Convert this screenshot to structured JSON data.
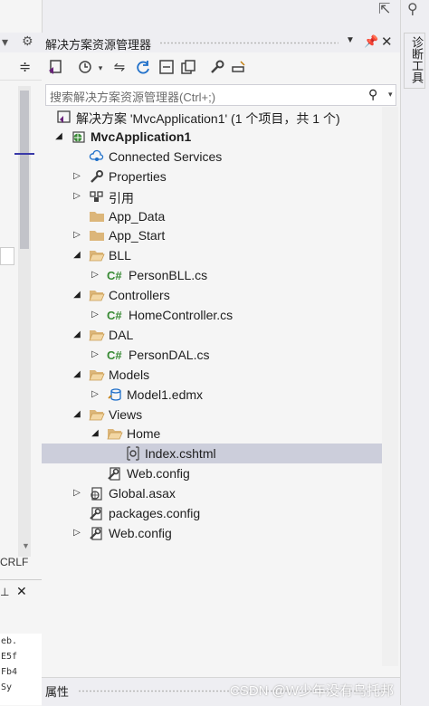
{
  "solution_explorer": {
    "title": "解决方案资源管理器",
    "search_placeholder": "搜索解决方案资源管理器(Ctrl+;)"
  },
  "tree": [
    {
      "label": "解决方案 'MvcApplication1' (1 个项目，共 1 个)",
      "icon": "solution-icon",
      "indent": 0,
      "expander": "",
      "bold": false,
      "selected": false
    },
    {
      "label": "MvcApplication1",
      "icon": "web-project-icon",
      "indent": 1,
      "expander": "expanded",
      "bold": true,
      "selected": false
    },
    {
      "label": "Connected Services",
      "icon": "connected-services-icon",
      "indent": 2,
      "expander": "",
      "bold": false,
      "selected": false
    },
    {
      "label": "Properties",
      "icon": "wrench-icon",
      "indent": 2,
      "expander": "collapsed",
      "bold": false,
      "selected": false
    },
    {
      "label": "引用",
      "icon": "references-icon",
      "indent": 2,
      "expander": "collapsed",
      "bold": false,
      "selected": false
    },
    {
      "label": "App_Data",
      "icon": "folder-icon",
      "indent": 2,
      "expander": "",
      "bold": false,
      "selected": false
    },
    {
      "label": "App_Start",
      "icon": "folder-icon",
      "indent": 2,
      "expander": "collapsed",
      "bold": false,
      "selected": false
    },
    {
      "label": "BLL",
      "icon": "folder-open-icon",
      "indent": 2,
      "expander": "expanded",
      "bold": false,
      "selected": false
    },
    {
      "label": "PersonBLL.cs",
      "icon": "csharp-file-icon",
      "indent": 3,
      "expander": "collapsed",
      "bold": false,
      "selected": false
    },
    {
      "label": "Controllers",
      "icon": "folder-open-icon",
      "indent": 2,
      "expander": "expanded",
      "bold": false,
      "selected": false
    },
    {
      "label": "HomeController.cs",
      "icon": "csharp-file-icon",
      "indent": 3,
      "expander": "collapsed",
      "bold": false,
      "selected": false
    },
    {
      "label": "DAL",
      "icon": "folder-open-icon",
      "indent": 2,
      "expander": "expanded",
      "bold": false,
      "selected": false
    },
    {
      "label": "PersonDAL.cs",
      "icon": "csharp-file-icon",
      "indent": 3,
      "expander": "collapsed",
      "bold": false,
      "selected": false
    },
    {
      "label": "Models",
      "icon": "folder-open-icon",
      "indent": 2,
      "expander": "expanded",
      "bold": false,
      "selected": false
    },
    {
      "label": "Model1.edmx",
      "icon": "edmx-file-icon",
      "indent": 3,
      "expander": "collapsed",
      "bold": false,
      "selected": false
    },
    {
      "label": "Views",
      "icon": "folder-open-icon",
      "indent": 2,
      "expander": "expanded",
      "bold": false,
      "selected": false
    },
    {
      "label": "Home",
      "icon": "folder-open-icon",
      "indent": 3,
      "expander": "expanded",
      "bold": false,
      "selected": false
    },
    {
      "label": "Index.cshtml",
      "icon": "razor-file-icon",
      "indent": 4,
      "expander": "",
      "bold": false,
      "selected": true
    },
    {
      "label": "Web.config",
      "icon": "config-file-icon",
      "indent": 3,
      "expander": "",
      "bold": false,
      "selected": false
    },
    {
      "label": "Global.asax",
      "icon": "global-asax-icon",
      "indent": 2,
      "expander": "collapsed",
      "bold": false,
      "selected": false
    },
    {
      "label": "packages.config",
      "icon": "config-file-icon",
      "indent": 2,
      "expander": "",
      "bold": false,
      "selected": false
    },
    {
      "label": "Web.config",
      "icon": "config-file-icon",
      "indent": 2,
      "expander": "collapsed",
      "bold": false,
      "selected": false
    }
  ],
  "properties_panel": {
    "title": "属性"
  },
  "right_strip": {
    "vertical_tab": "诊断工具"
  },
  "left_strip": {
    "line_ending": "CRLF",
    "code_fragments": [
      "eb.",
      "E5f",
      "Fb4",
      "Sy"
    ]
  },
  "watermark": "CSDN @W少年没有乌托邦",
  "colors": {
    "selection": "#cccedb",
    "folder": "#dcb67a",
    "csharp": "#388a34",
    "panel": "#f5f5f5"
  }
}
